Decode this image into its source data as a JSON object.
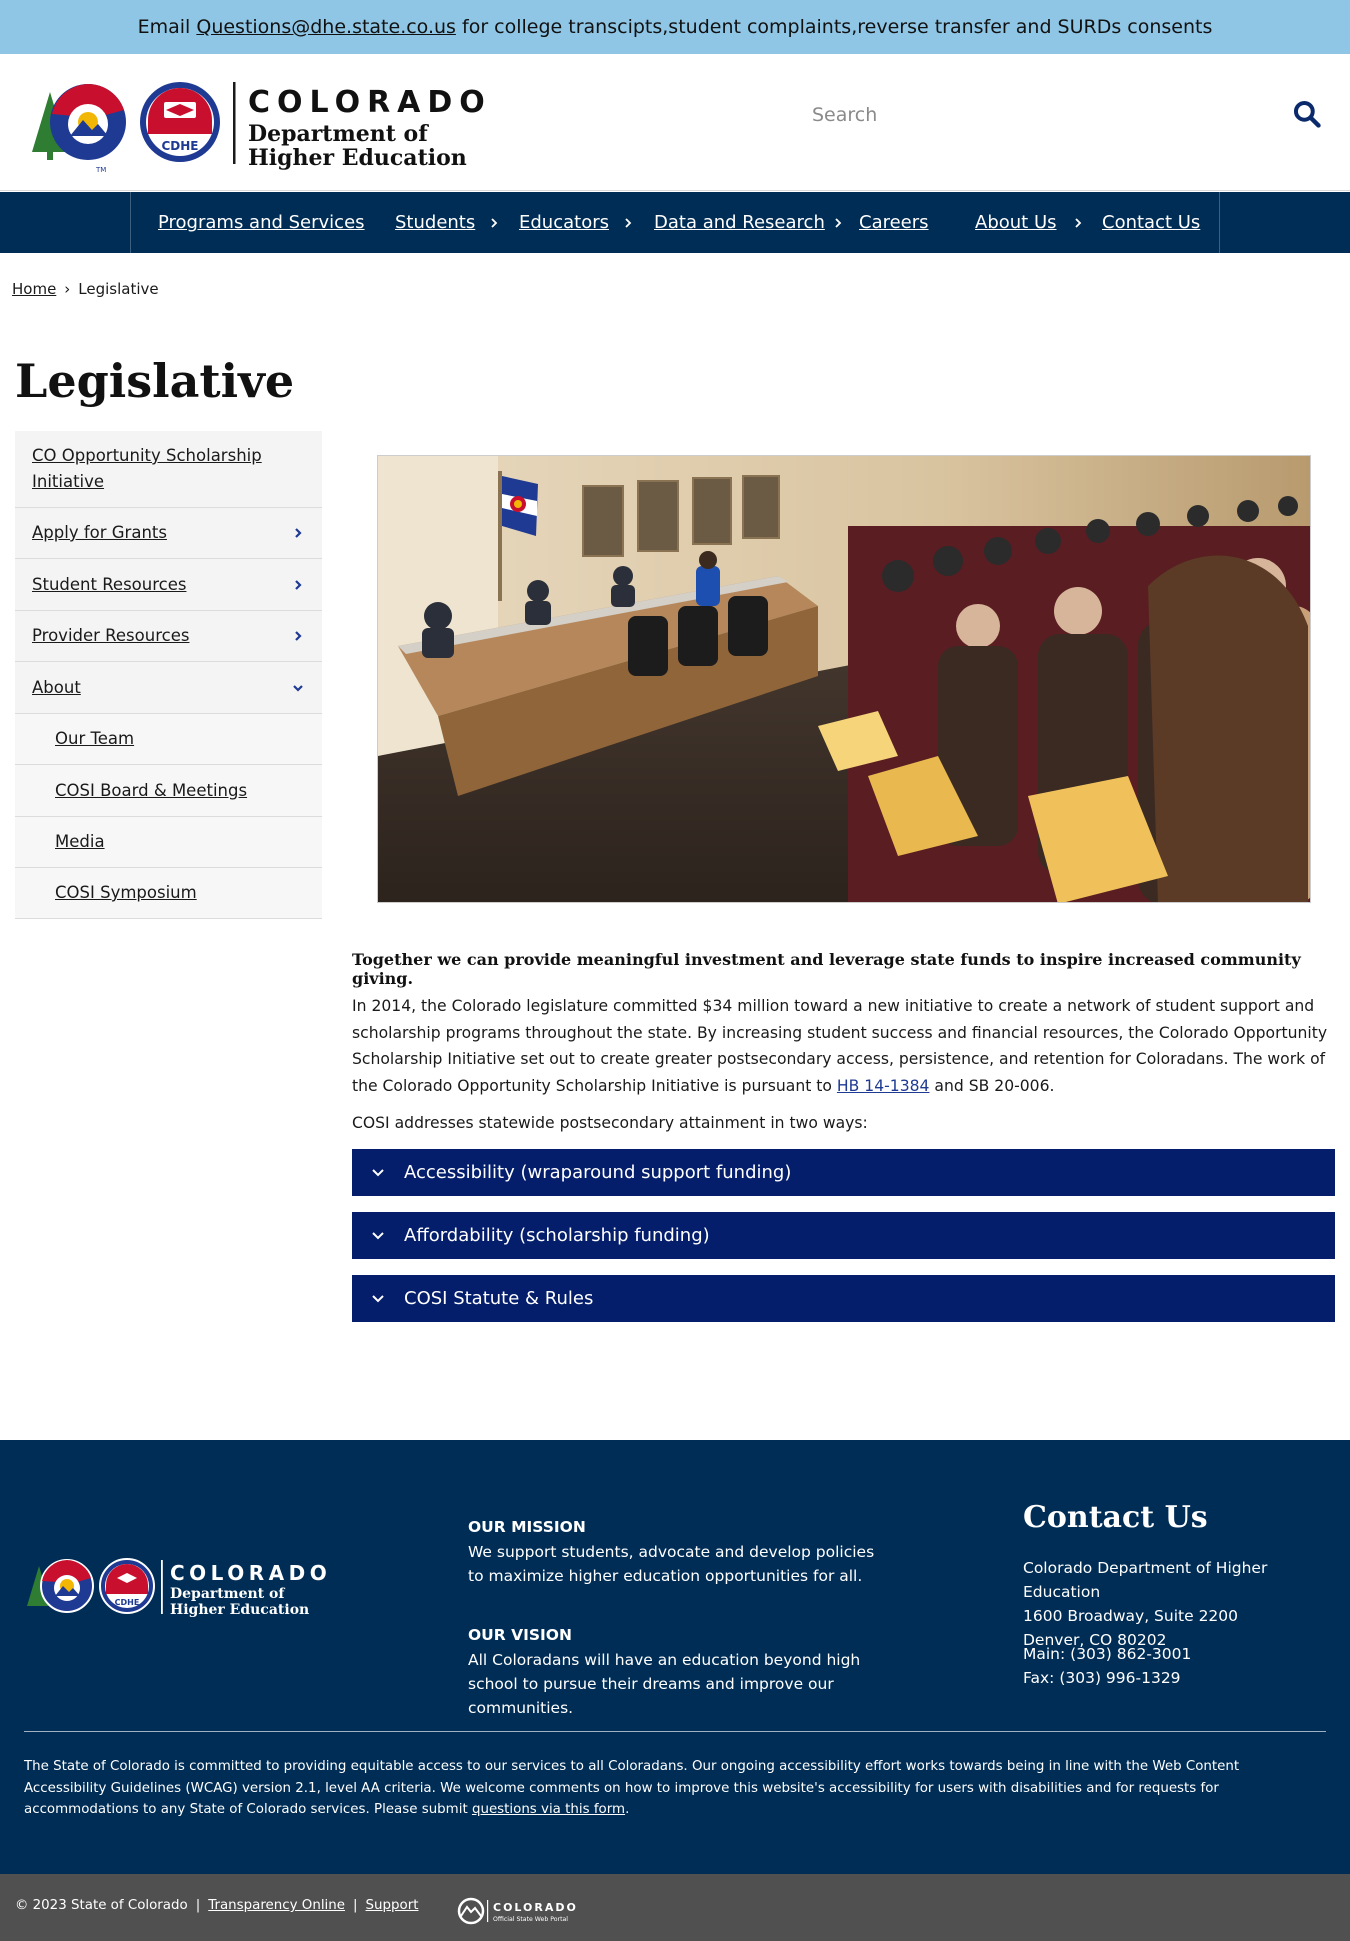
{
  "alert": {
    "prefix": "Email ",
    "email": "Questions@dhe.state.co.us",
    "suffix": " for college transcipts,student complaints,reverse transfer and SURDs consents"
  },
  "header": {
    "logo": {
      "state_word": "COLORADO",
      "dept_line1": "Department of",
      "dept_line2": "Higher Education",
      "badge": "CDHE"
    },
    "search": {
      "placeholder": "Search",
      "icon": "search-icon"
    }
  },
  "nav": {
    "items": [
      {
        "label": "Programs and Services",
        "has_children": false
      },
      {
        "label": "Students",
        "has_children": true
      },
      {
        "label": "Educators",
        "has_children": true
      },
      {
        "label": "Data and Research",
        "has_children": true
      },
      {
        "label": "Careers",
        "has_children": false
      },
      {
        "label": "About Us",
        "has_children": true
      },
      {
        "label": "Contact Us",
        "has_children": false
      }
    ]
  },
  "breadcrumb": {
    "home": "Home",
    "separator": "›",
    "current": "Legislative"
  },
  "page": {
    "title": "Legislative"
  },
  "sidebar": {
    "items": [
      {
        "label": "CO Opportunity Scholarship Initiative",
        "icon": ""
      },
      {
        "label": "Apply for Grants",
        "icon": "chevron-right-icon"
      },
      {
        "label": "Student Resources",
        "icon": "chevron-right-icon"
      },
      {
        "label": "Provider Resources",
        "icon": "chevron-right-icon"
      },
      {
        "label": "About",
        "icon": "chevron-down-icon"
      },
      {
        "label": "Our Team",
        "icon": ""
      },
      {
        "label": "COSI Board & Meetings",
        "icon": ""
      },
      {
        "label": "Media",
        "icon": ""
      },
      {
        "label": "COSI Symposium",
        "icon": ""
      }
    ]
  },
  "content": {
    "lead": "Together we can provide meaningful investment and leverage state funds to inspire increased community giving.",
    "body_before_link": "In 2014, the Colorado legislature committed $34 million toward a new initiative to create a network of student support and scholarship programs throughout the state. By increasing student success and financial resources, the Colorado Opportunity Scholarship Initiative set out to create greater postsecondary access, persistence, and retention for Coloradans. The work of the Colorado Opportunity Scholarship Initiative is pursuant to ",
    "body_link": "HB 14-1384",
    "body_after_link": " and SB 20-006.",
    "ways": "COSI addresses statewide postsecondary attainment in two ways:",
    "accordions": [
      {
        "label": "Accessibility (wraparound support funding)"
      },
      {
        "label": "Affordability (scholarship funding)"
      },
      {
        "label": "COSI Statute & Rules"
      }
    ]
  },
  "footer": {
    "mission_heading": "OUR MISSION",
    "mission_text": "We support students, advocate and develop policies to maximize higher education opportunities for all.",
    "vision_heading": "OUR VISION",
    "vision_text": "All Coloradans will have an education beyond high school to pursue their dreams and improve our communities.",
    "contact_heading": "Contact Us",
    "address_line1": "Colorado Department of Higher Education",
    "address_line2": "1600 Broadway, Suite 2200",
    "address_line3": "Denver, CO 80202",
    "phone_main": "Main: (303) 862-3001",
    "phone_fax": "Fax: (303) 996-1329",
    "a11y_text": "The State of Colorado is committed to providing equitable access to our services to all Coloradans. Our ongoing accessibility effort works towards being in line with the Web Content Accessibility Guidelines (WCAG) version 2.1, level AA criteria. We welcome comments on how to improve this website's accessibility for users with disabilities and for requests for accommodations to any State of Colorado services. Please submit ",
    "a11y_link": "questions via this form",
    "a11y_end": "."
  },
  "bottom": {
    "copyright": "© 2023 State of Colorado",
    "sep": "|",
    "transparency": "Transparency Online",
    "support": "Support",
    "portal_word": "COLORADO",
    "portal_sub": "Official State Web Portal"
  },
  "colors": {
    "alert_bg": "#8fc6e6",
    "navy": "#002d55",
    "accordion": "#041e6c",
    "bottom_bar": "#505050",
    "logo_red": "#c8102e",
    "logo_blue": "#1f3a93",
    "logo_green": "#2e7d32",
    "logo_gold": "#f2b705"
  }
}
